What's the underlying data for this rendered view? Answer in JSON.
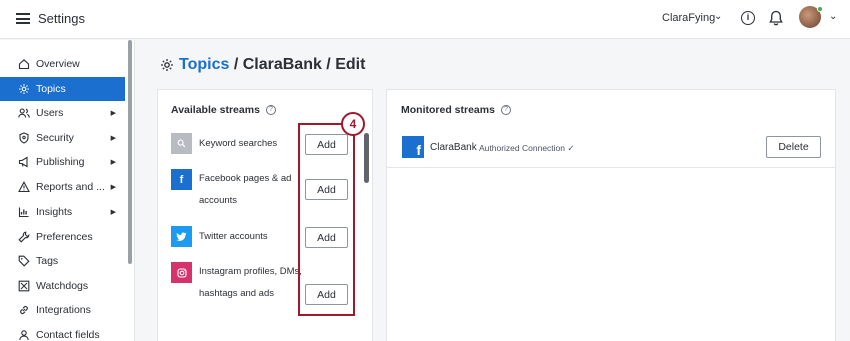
{
  "header": {
    "app_title": "Settings",
    "user_name": "ClaraFying"
  },
  "sidebar": {
    "items": [
      {
        "label": "Overview",
        "icon": "home-icon",
        "active": false,
        "has_arrow": false
      },
      {
        "label": "Topics",
        "icon": "gear-icon",
        "active": true,
        "has_arrow": false
      },
      {
        "label": "Users",
        "icon": "users-icon",
        "active": false,
        "has_arrow": true
      },
      {
        "label": "Security",
        "icon": "shield-icon",
        "active": false,
        "has_arrow": true
      },
      {
        "label": "Publishing",
        "icon": "megaphone-icon",
        "active": false,
        "has_arrow": true
      },
      {
        "label": "Reports and ...",
        "icon": "warning-icon",
        "active": false,
        "has_arrow": true
      },
      {
        "label": "Insights",
        "icon": "chart-icon",
        "active": false,
        "has_arrow": true
      },
      {
        "label": "Preferences",
        "icon": "wrench-icon",
        "active": false,
        "has_arrow": false
      },
      {
        "label": "Tags",
        "icon": "tag-icon",
        "active": false,
        "has_arrow": false
      },
      {
        "label": "Watchdogs",
        "icon": "hourglass-icon",
        "active": false,
        "has_arrow": false
      },
      {
        "label": "Integrations",
        "icon": "link-icon",
        "active": false,
        "has_arrow": false
      },
      {
        "label": "Contact fields",
        "icon": "person-icon",
        "active": false,
        "has_arrow": false
      }
    ]
  },
  "page": {
    "title_link": "Topics",
    "title_rest": " / ClaraBank / Edit"
  },
  "available": {
    "heading": "Available streams",
    "streams": [
      {
        "label": "Keyword searches",
        "icon": "search-icon",
        "color": "#b8bcc2",
        "button": "Add"
      },
      {
        "label": "Facebook pages & ad accounts",
        "icon": "facebook-icon",
        "color": "#1a6fcf",
        "button": "Add"
      },
      {
        "label": "Twitter accounts",
        "icon": "twitter-icon",
        "color": "#1d9bf0",
        "button": "Add"
      },
      {
        "label": "Instagram profiles, DMs, hashtags and ads",
        "icon": "instagram-icon",
        "color": "#d6336c",
        "button": "Add"
      }
    ]
  },
  "monitored": {
    "heading": "Monitored streams",
    "stream_name": "ClaraBank",
    "stream_status": "Authorized Connection",
    "delete_label": "Delete"
  },
  "annotation": {
    "step": "4",
    "color": "#a0182c"
  },
  "colors": {
    "accent": "#1a6fcf"
  }
}
